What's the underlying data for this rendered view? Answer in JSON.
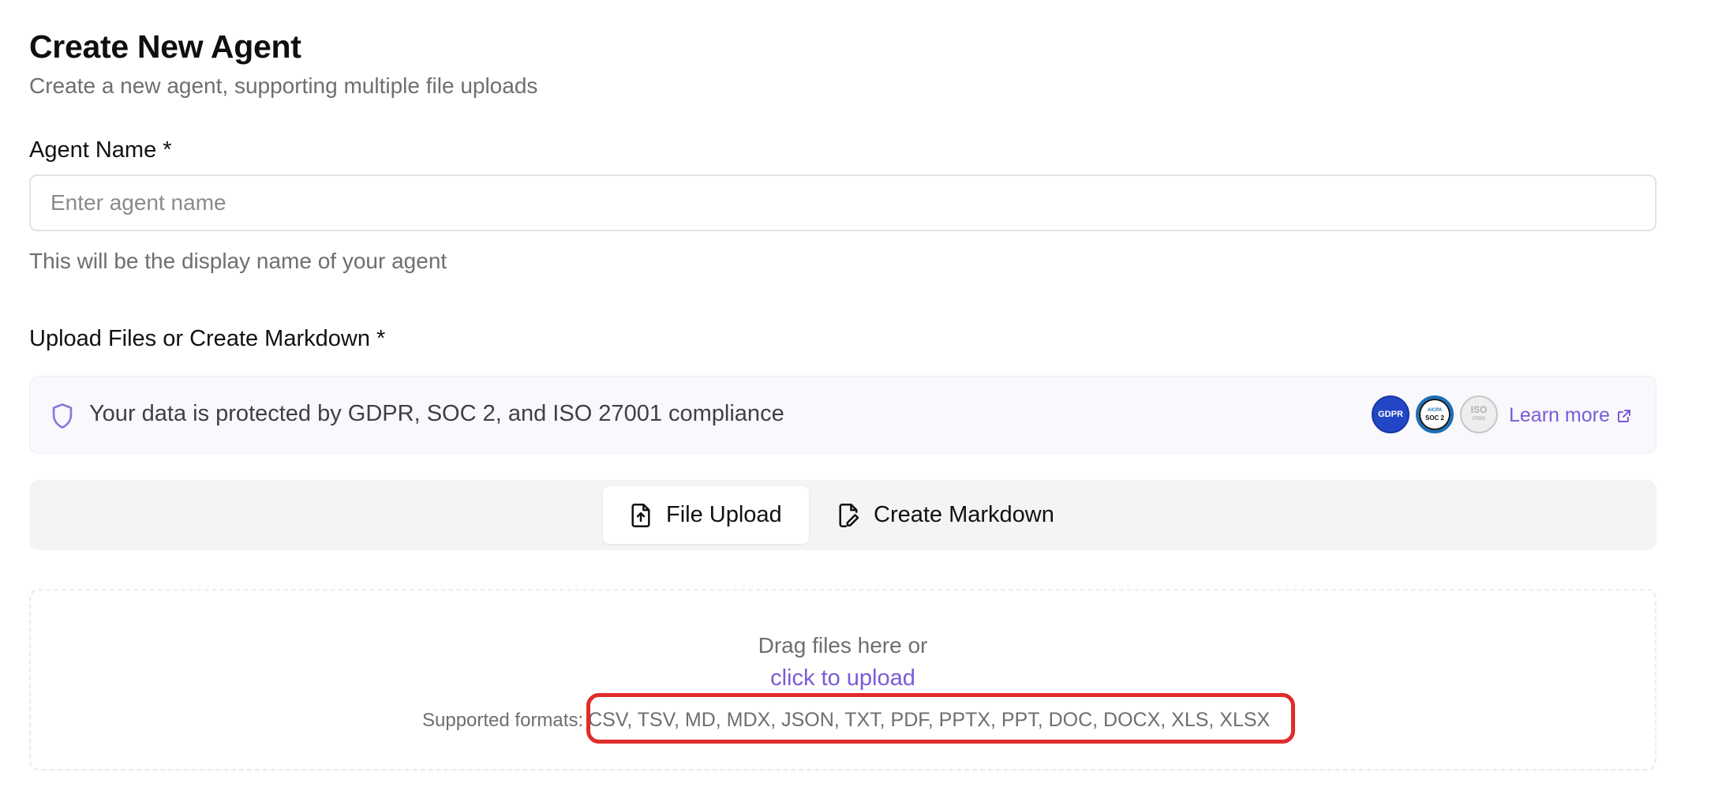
{
  "header": {
    "title": "Create New Agent",
    "subtitle": "Create a new agent, supporting multiple file uploads"
  },
  "agent_name": {
    "label": "Agent Name *",
    "placeholder": "Enter agent name",
    "value": "",
    "help": "This will be the display name of your agent"
  },
  "upload": {
    "label": "Upload Files or Create Markdown *"
  },
  "compliance": {
    "text": "Your data is protected by GDPR, SOC 2, and ISO 27001 compliance",
    "badges": {
      "gdpr": "GDPR",
      "soc_top": "AICPA",
      "soc": "SOC 2",
      "iso": "ISO",
      "iso_sub": "27001"
    },
    "learn_more": "Learn more",
    "accent_color": "#7a5bd6"
  },
  "tabs": [
    {
      "label": "File Upload",
      "icon": "file-upload-icon",
      "active": true
    },
    {
      "label": "Create Markdown",
      "icon": "file-edit-icon",
      "active": false
    }
  ],
  "dropzone": {
    "drag_text": "Drag files here or",
    "click_text": "click to upload",
    "formats_label": "Supported formats:",
    "formats": "CSV, TSV, MD, MDX, JSON, TXT, PDF, PPTX, PPT, DOC, DOCX, XLS, XLSX"
  },
  "annotation": {
    "color": "#e02b2b"
  }
}
